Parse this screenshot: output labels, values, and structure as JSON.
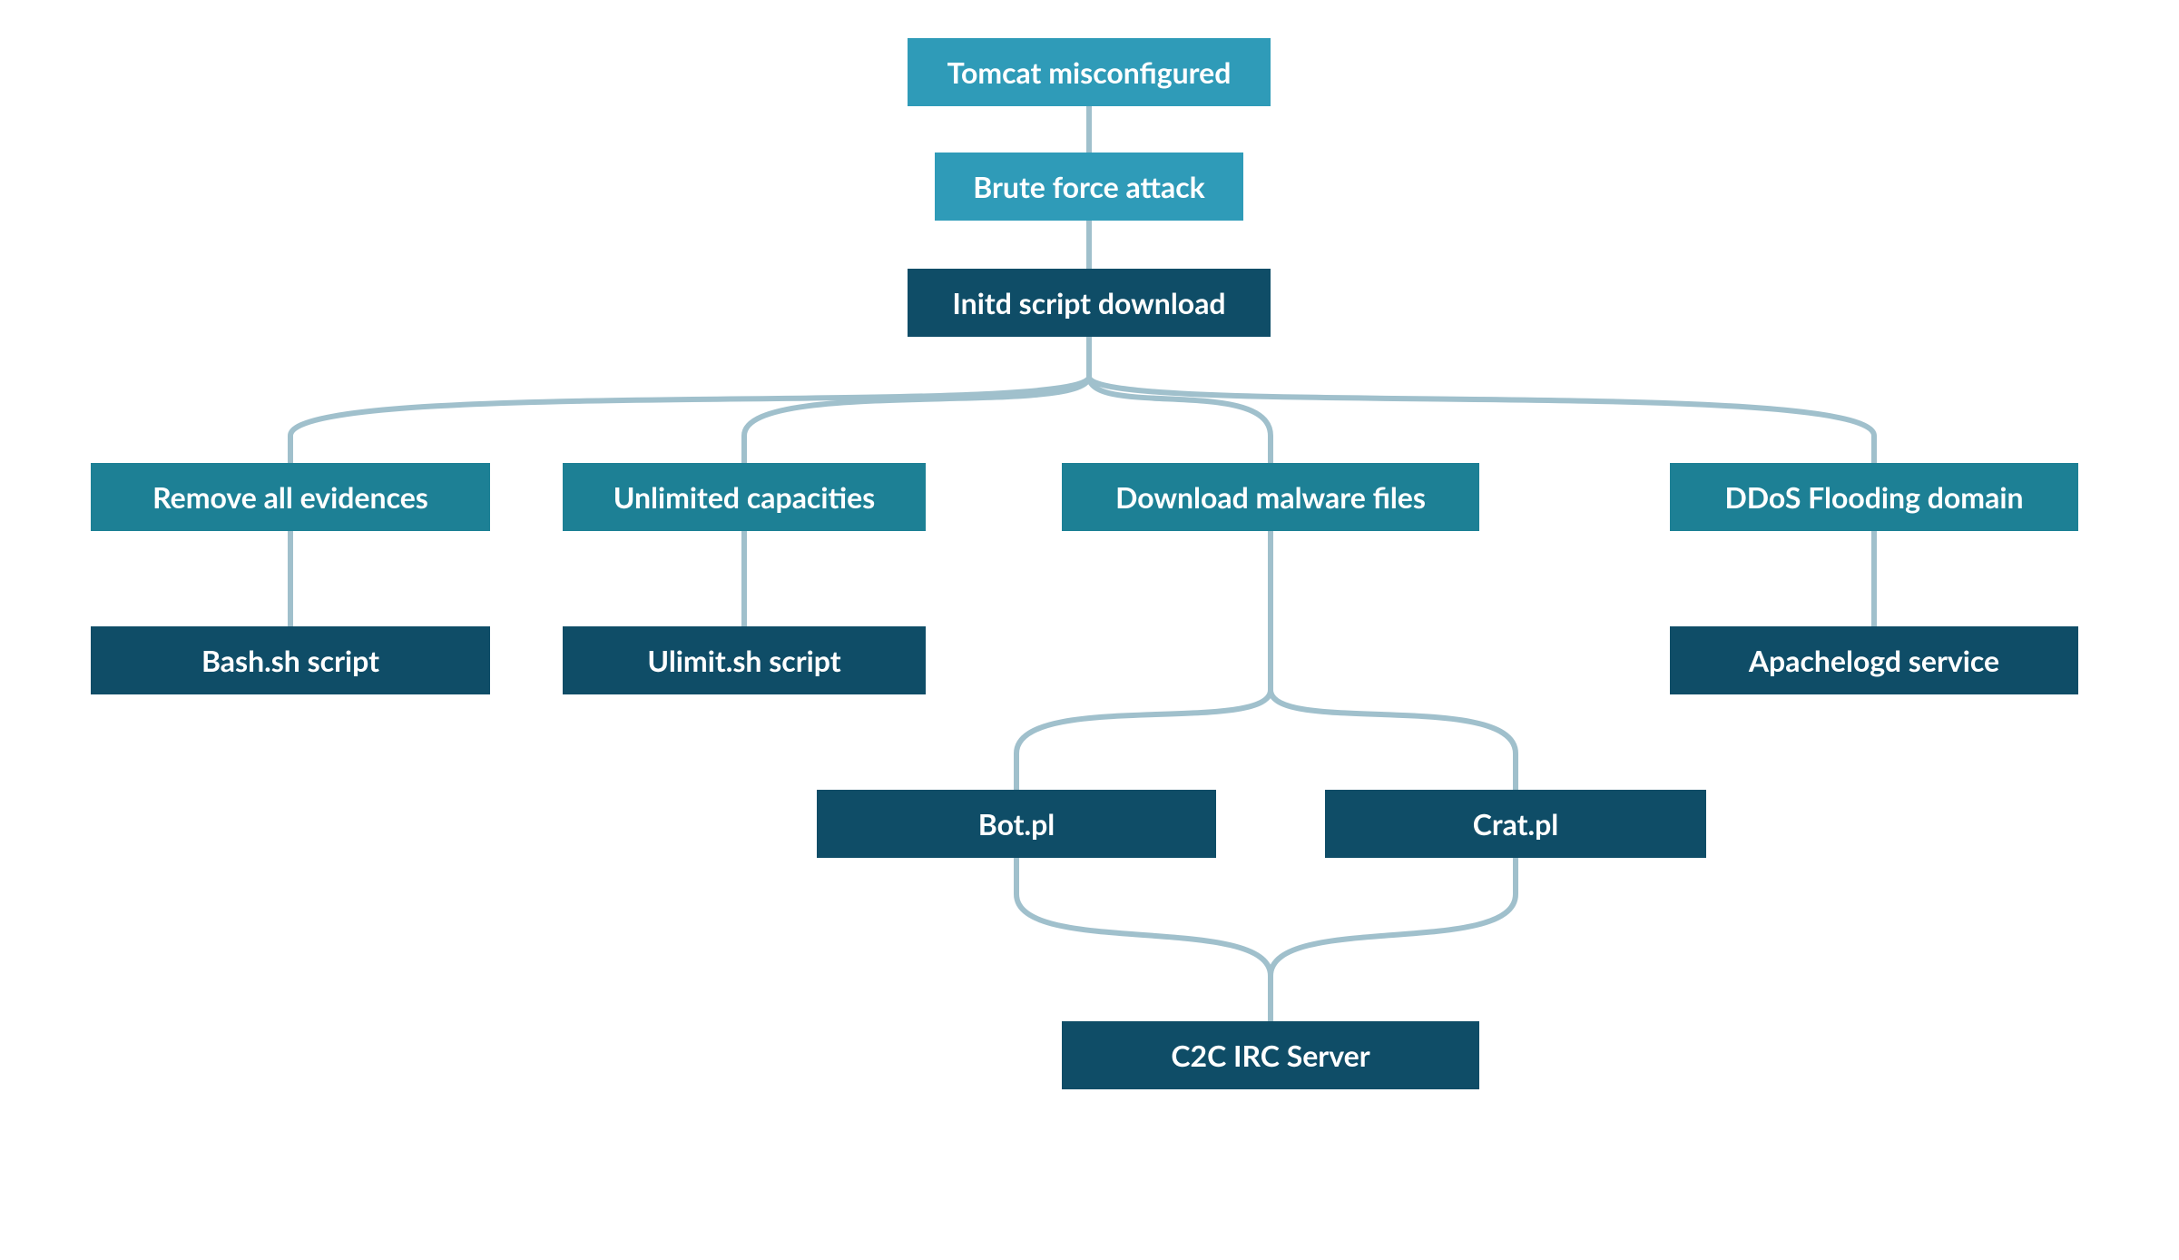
{
  "diagram": {
    "nodes": {
      "n1": "Tomcat misconfigured",
      "n2": "Brute force attack",
      "n3": "Initd script download",
      "n4": "Remove all evidences",
      "n5": "Unlimited capacities",
      "n6": "Download malware files",
      "n7": "DDoS Flooding domain",
      "n8": "Bash.sh script",
      "n9": "Ulimit.sh script",
      "n10": "Apachelogd service",
      "n11": "Bot.pl",
      "n12": "Crat.pl",
      "n13": "C2C IRC Server"
    },
    "structure": {
      "root": "n1",
      "chain": [
        "n1",
        "n2",
        "n3"
      ],
      "n3_children": [
        "n4",
        "n5",
        "n6",
        "n7"
      ],
      "n4_child": "n8",
      "n5_child": "n9",
      "n6_children": [
        "n11",
        "n12"
      ],
      "n7_child": "n10",
      "n11_n12_merge": "n13"
    }
  }
}
